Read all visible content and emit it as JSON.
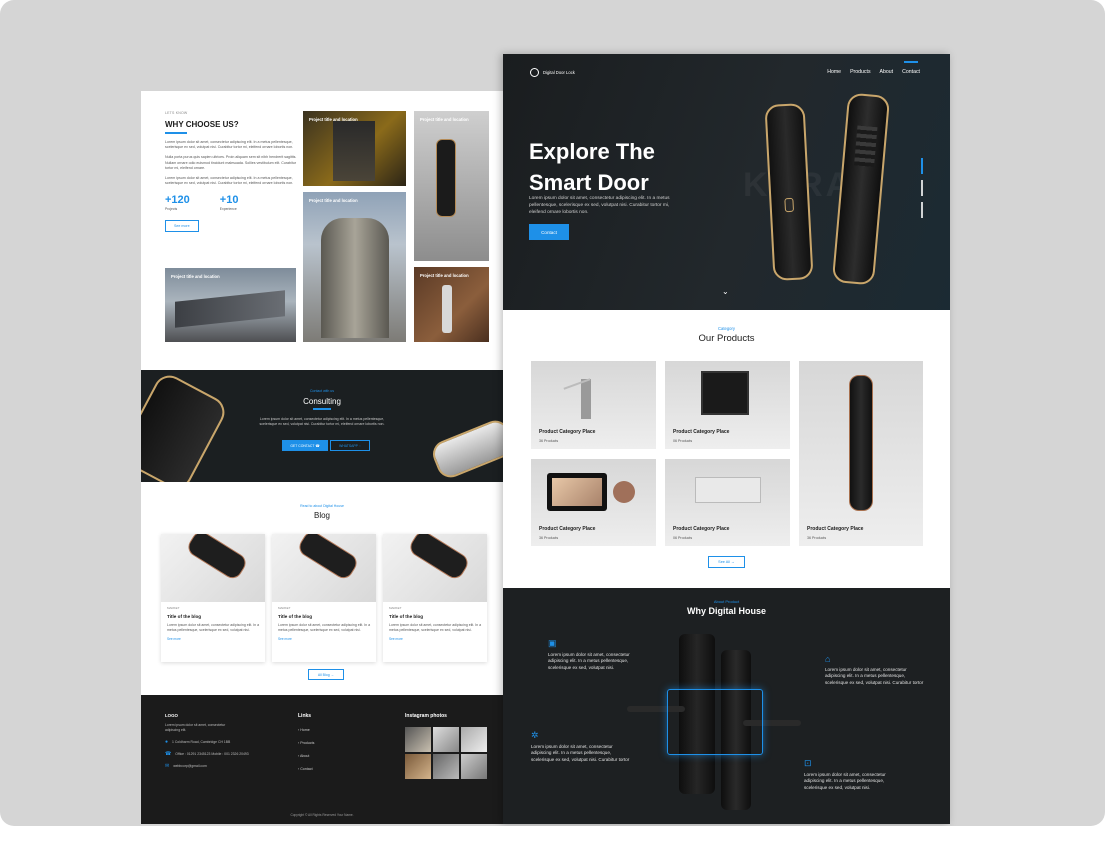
{
  "left_page": {
    "why": {
      "eyebrow": "LETS KNOW",
      "title": "WHY CHOOSE US?",
      "paragraphs": [
        "Lorem ipsum dolor sit amet, consectetur adipiscing elit. In a metus pellentesque, scelerisque ex sed, volutpat nisi. Curabitur tortor mi, eleifend ornare lobortis non.",
        "Nulla porta purus quis sapien ultrices. Proin aliquam sem sit nibh hendrerit sagittis. Nullam ornare odio euismod tincidunt malesuada. Sollies vestibulum elit. Curabitur tortor mi, eleifend ornare.",
        "Lorem ipsum dolor sit amet, consectetur adipiscing elit. In a metus pellentesque, scelerisque ex sed, volutpat nisi. Curabitur tortor mi, eleifend ornare lobortis non."
      ],
      "stats": [
        {
          "num": "+120",
          "label": "Projects"
        },
        {
          "num": "+10",
          "label": "Experience"
        }
      ],
      "see_more": "See more"
    },
    "projects": [
      {
        "caption": "Project title and location"
      },
      {
        "caption": "Project title and location"
      },
      {
        "caption": "Project title and location"
      },
      {
        "caption": "Project title and location"
      },
      {
        "caption": "Project title and location"
      }
    ],
    "consulting": {
      "eyebrow": "Contact with us",
      "title": "Consulting",
      "text": "Lorem ipsum dolor sit amet, consectetur adipiscing elit. In a metus pellentesque, scelerisque ex sed, volutpat nisi. Curabitur tortor mi, eleifend ornare lobortis non.",
      "btn_primary": "GET CONTACT",
      "btn_secondary": "WHATSAPP"
    },
    "blog": {
      "eyebrow": "Read to about Digital House",
      "title": "Blog",
      "cards": [
        {
          "cat": "MARKET",
          "title": "Title of the blog",
          "text": "Lorem ipsum dolor sit amet, consectetur adipiscing elit. In a metus pellentesque, scelerisque ex sed, volutpat nisi.",
          "more": "See more"
        },
        {
          "cat": "MARKET",
          "title": "Title of the blog",
          "text": "Lorem ipsum dolor sit amet, consectetur adipiscing elit. In a metus pellentesque, scelerisque ex sed, volutpat nisi.",
          "more": "See more"
        },
        {
          "cat": "MARKET",
          "title": "Title of the blog",
          "text": "Lorem ipsum dolor sit amet, consectetur adipiscing elit. In a metus pellentesque, scelerisque ex sed, volutpat nisi.",
          "more": "See more"
        }
      ],
      "all_blog": "All Blog"
    },
    "footer": {
      "logo": "LOGO",
      "desc": "Lorem ipsum dolor sit amet, consectetur adipiscing elit.",
      "address": "1 Coldharm Road, Cambridge CH 1BB",
      "phone": "Office : 01291 2345123  Mobile : 001 2326 20493",
      "email": "webbcorp@gmail.com",
      "links_title": "Links",
      "links": [
        "Home",
        "Products",
        "About",
        "Contact"
      ],
      "instagram_title": "Instagram photos",
      "copyright": "Copyright © All Rights Reserved Your Name."
    }
  },
  "right_page": {
    "brand": "Digital Door Lock",
    "nav": [
      "Home",
      "Products",
      "About",
      "Contact"
    ],
    "hero": {
      "title": "Explore The Smart Door",
      "text": "Lorem ipsum dolor sit amet, consectetur adipiscing elit. In a metus pellentesque, scelerisque ex sed, volutpat nisi. Curabitur tortor mi, eleifend ornare lobortis non.",
      "button": "Contact",
      "watermark": "KARAS"
    },
    "products": {
      "eyebrow": "Category",
      "title": "Our Products",
      "items": [
        {
          "name": "Product Category Place",
          "count": "36 Products"
        },
        {
          "name": "Product Category Place",
          "count": "06 Products"
        },
        {
          "name": "Product Category Place",
          "count": "36 Products"
        },
        {
          "name": "Product Category Place",
          "count": "06 Products"
        },
        {
          "name": "Product Category Place",
          "count": "36 Products"
        }
      ],
      "see_all": "See All"
    },
    "why_digital": {
      "eyebrow": "About Product",
      "title": "Why Digital House",
      "features": [
        {
          "text": "Lorem ipsum dolor sit amet, consectetur adipiscing elit. In a metus pellentesque, scelerisque ex sed, volutpat nisi."
        },
        {
          "text": "Lorem ipsum dolor sit amet, consectetur adipiscing elit. In a metus pellentesque, scelerisque ex sed, volutpat nisi. Curabitur tortor"
        },
        {
          "text": "Lorem ipsum dolor sit amet, consectetur adipiscing elit. In a metus pellentesque, scelerisque ex sed, volutpat nisi. Curabitur tortor"
        },
        {
          "text": "Lorem ipsum dolor sit amet, consectetur adipiscing elit. In a metus pellentesque, scelerisque ex sed, volutpat nisi."
        }
      ]
    }
  },
  "colors": {
    "accent": "#1e90e8",
    "dark": "#1b1f21",
    "gold": "#c9a66b"
  }
}
